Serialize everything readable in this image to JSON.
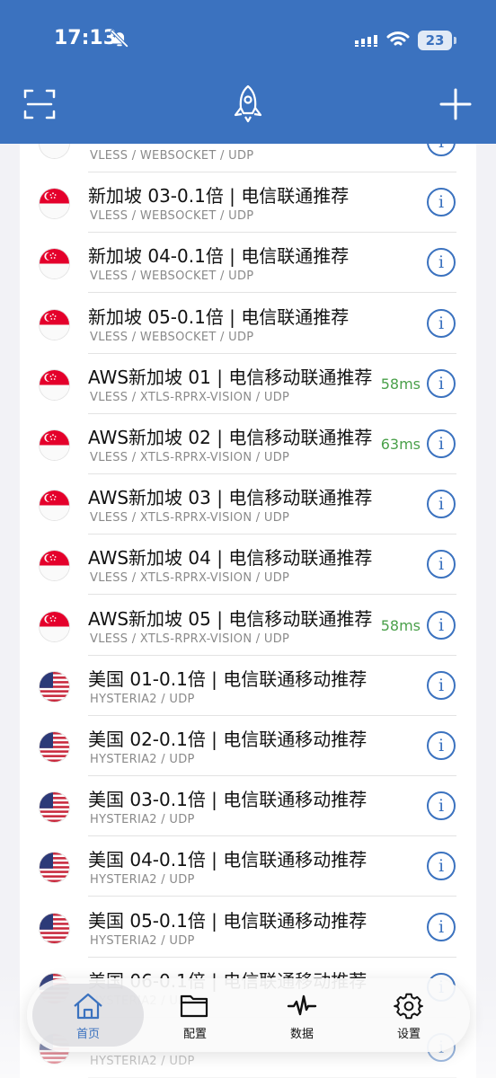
{
  "status": {
    "time": "17:13",
    "battery": "23"
  },
  "colors": {
    "primary": "#3b72bf",
    "latency": "#4aa04a"
  },
  "header": {
    "left_icon": "scan-icon",
    "center_icon": "rocket-icon",
    "right_icon": "plus-icon"
  },
  "servers": [
    {
      "name": "",
      "proto": "VLESS / WEBSOCKET / UDP",
      "latency": "",
      "flag": "sg"
    },
    {
      "name": "新加坡 03-0.1倍 | 电信联通推荐",
      "proto": "VLESS / WEBSOCKET / UDP",
      "latency": "",
      "flag": "sg"
    },
    {
      "name": "新加坡 04-0.1倍 | 电信联通推荐",
      "proto": "VLESS / WEBSOCKET / UDP",
      "latency": "",
      "flag": "sg"
    },
    {
      "name": "新加坡 05-0.1倍 | 电信联通推荐",
      "proto": "VLESS / WEBSOCKET / UDP",
      "latency": "",
      "flag": "sg"
    },
    {
      "name": "AWS新加坡 01 | 电信移动联通推荐",
      "proto": "VLESS / XTLS-RPRX-VISION / UDP",
      "latency": "58ms",
      "flag": "sg"
    },
    {
      "name": "AWS新加坡 02 | 电信移动联通推荐",
      "proto": "VLESS / XTLS-RPRX-VISION / UDP",
      "latency": "63ms",
      "flag": "sg"
    },
    {
      "name": "AWS新加坡 03 | 电信移动联通推荐",
      "proto": "VLESS / XTLS-RPRX-VISION / UDP",
      "latency": "",
      "flag": "sg"
    },
    {
      "name": "AWS新加坡 04 | 电信移动联通推荐",
      "proto": "VLESS / XTLS-RPRX-VISION / UDP",
      "latency": "",
      "flag": "sg"
    },
    {
      "name": "AWS新加坡 05 | 电信移动联通推荐",
      "proto": "VLESS / XTLS-RPRX-VISION / UDP",
      "latency": "58ms",
      "flag": "sg"
    },
    {
      "name": "美国 01-0.1倍 | 电信联通移动推荐",
      "proto": "HYSTERIA2 / UDP",
      "latency": "",
      "flag": "us"
    },
    {
      "name": "美国 02-0.1倍 | 电信联通移动推荐",
      "proto": "HYSTERIA2 / UDP",
      "latency": "",
      "flag": "us"
    },
    {
      "name": "美国 03-0.1倍 | 电信联通移动推荐",
      "proto": "HYSTERIA2 / UDP",
      "latency": "",
      "flag": "us"
    },
    {
      "name": "美国 04-0.1倍 | 电信联通移动推荐",
      "proto": "HYSTERIA2 / UDP",
      "latency": "",
      "flag": "us"
    },
    {
      "name": "美国 05-0.1倍 | 电信联通移动推荐",
      "proto": "HYSTERIA2 / UDP",
      "latency": "",
      "flag": "us"
    },
    {
      "name": "美国 06-0.1倍 | 电信联通移动推荐",
      "proto": "HYSTERIA2 / UDP",
      "latency": "",
      "flag": "us"
    },
    {
      "name": "",
      "proto": "HYSTERIA2 / UDP",
      "latency": "",
      "flag": "us"
    }
  ],
  "tabs": [
    {
      "label": "首页",
      "icon": "home-icon"
    },
    {
      "label": "配置",
      "icon": "folder-icon"
    },
    {
      "label": "数据",
      "icon": "activity-icon"
    },
    {
      "label": "设置",
      "icon": "gear-icon"
    }
  ]
}
